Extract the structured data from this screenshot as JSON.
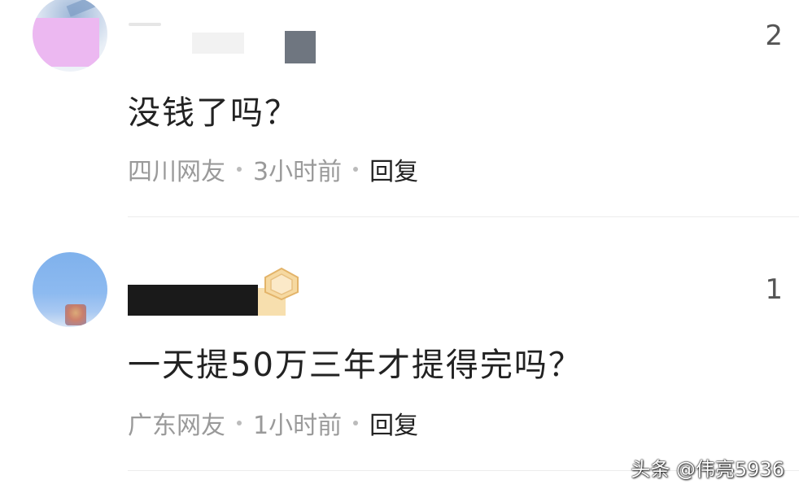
{
  "comments": [
    {
      "likes": "2",
      "text": "没钱了吗？",
      "location": "四川网友",
      "time": "3小时前",
      "reply_label": "回复"
    },
    {
      "likes": "1",
      "text": "一天提50万三年才提得完吗？",
      "location": "广东网友",
      "time": "1小时前",
      "reply_label": "回复"
    }
  ],
  "watermark": "头条 @伟亮5936",
  "colors": {
    "text_primary": "#222222",
    "text_secondary": "#9a9a9a",
    "divider": "#ececec"
  }
}
